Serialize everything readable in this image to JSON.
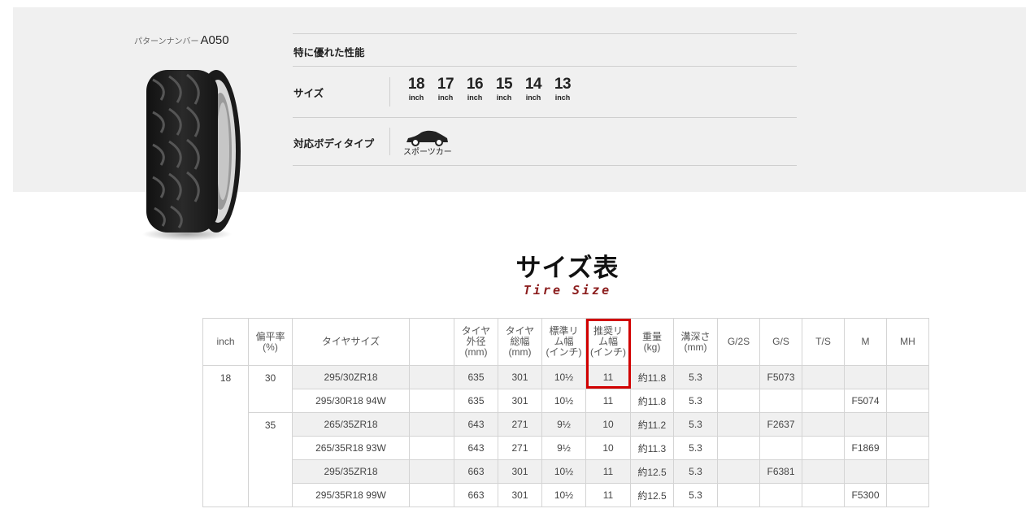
{
  "pattern": {
    "prefix": "パターンナンバー",
    "code": "A050"
  },
  "specs": {
    "performance_label": "特に優れた性能",
    "size_label": "サイズ",
    "body_label": "対応ボディタイプ",
    "inches": [
      {
        "num": "18",
        "unit": "inch"
      },
      {
        "num": "17",
        "unit": "inch"
      },
      {
        "num": "16",
        "unit": "inch"
      },
      {
        "num": "15",
        "unit": "inch"
      },
      {
        "num": "14",
        "unit": "inch"
      },
      {
        "num": "13",
        "unit": "inch"
      }
    ],
    "body_type": "スポーツカー"
  },
  "title": "サイズ表",
  "subtitle": "Tire Size",
  "table": {
    "headers": {
      "inch": "inch",
      "aspect": "偏平率\n(%)",
      "size": "タイヤサイズ",
      "blank": "",
      "diameter": "タイヤ\n外径\n(mm)",
      "width": "タイヤ\n総幅\n(mm)",
      "std_rim": "標準リ\nム幅\n(インチ)",
      "rec_rim": "推奨リ\nム幅\n(インチ)",
      "weight": "重量\n(kg)",
      "depth": "溝深さ\n(mm)",
      "g2s": "G/2S",
      "gs": "G/S",
      "ts": "T/S",
      "m": "M",
      "mh": "MH"
    },
    "inch_value": "18",
    "aspect_30": "30",
    "aspect_35": "35",
    "rows": [
      {
        "size": "295/30ZR18",
        "diameter": "635",
        "width": "301",
        "std_rim": "10½",
        "rec_rim": "11",
        "weight": "約11.8",
        "depth": "5.3",
        "g2s": "",
        "gs": "F5073",
        "ts": "",
        "m": "",
        "mh": ""
      },
      {
        "size": "295/30R18 94W",
        "diameter": "635",
        "width": "301",
        "std_rim": "10½",
        "rec_rim": "11",
        "weight": "約11.8",
        "depth": "5.3",
        "g2s": "",
        "gs": "",
        "ts": "",
        "m": "F5074",
        "mh": ""
      },
      {
        "size": "265/35ZR18",
        "diameter": "643",
        "width": "271",
        "std_rim": "9½",
        "rec_rim": "10",
        "weight": "約11.2",
        "depth": "5.3",
        "g2s": "",
        "gs": "F2637",
        "ts": "",
        "m": "",
        "mh": ""
      },
      {
        "size": "265/35R18 93W",
        "diameter": "643",
        "width": "271",
        "std_rim": "9½",
        "rec_rim": "10",
        "weight": "約11.3",
        "depth": "5.3",
        "g2s": "",
        "gs": "",
        "ts": "",
        "m": "F1869",
        "mh": ""
      },
      {
        "size": "295/35ZR18",
        "diameter": "663",
        "width": "301",
        "std_rim": "10½",
        "rec_rim": "11",
        "weight": "約12.5",
        "depth": "5.3",
        "g2s": "",
        "gs": "F6381",
        "ts": "",
        "m": "",
        "mh": ""
      },
      {
        "size": "295/35R18 99W",
        "diameter": "663",
        "width": "301",
        "std_rim": "10½",
        "rec_rim": "11",
        "weight": "約12.5",
        "depth": "5.3",
        "g2s": "",
        "gs": "",
        "ts": "",
        "m": "F5300",
        "mh": ""
      }
    ]
  },
  "colors": {
    "accent": "#d10000",
    "subtitle": "#8b1c1c",
    "panel": "#f0f0f0"
  }
}
